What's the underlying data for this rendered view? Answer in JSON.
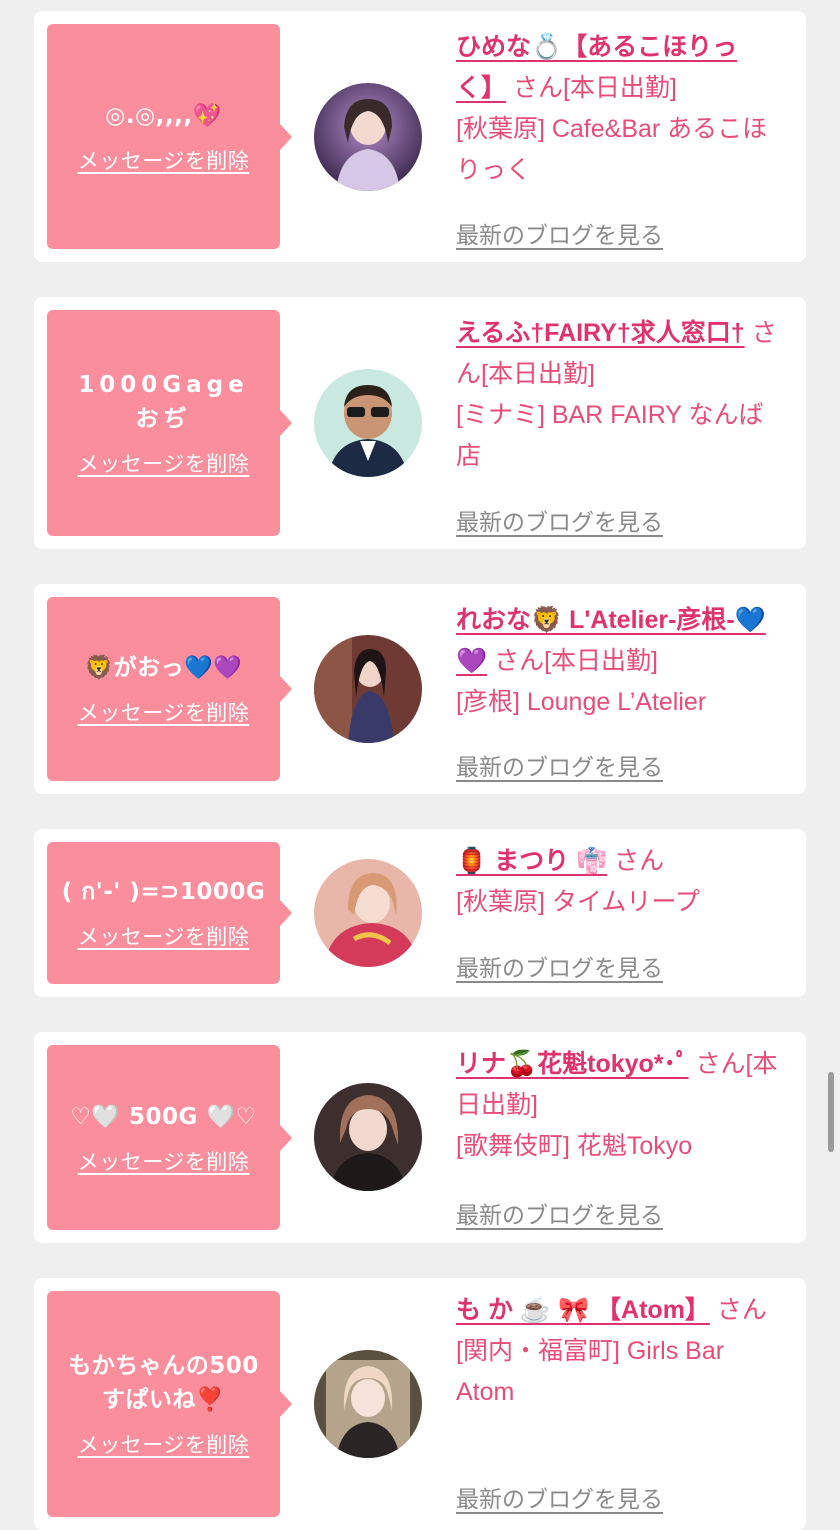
{
  "cards": [
    {
      "message": "◎.◎,,,,💖",
      "delete_label": "メッセージを削除",
      "cast_name": "ひめな💍【あるこほりっく】",
      "suffix": "さん[本日出勤]",
      "shop": "[秋葉原] Cafe&Bar あるこほりっく",
      "blog_label": "最新のブログを見る"
    },
    {
      "message": "1000Gage\nおぢ",
      "delete_label": "メッセージを削除",
      "cast_name": "えるふ†FAIRY†求人窓口†",
      "suffix": "さん[本日出勤]",
      "shop": "[ミナミ] BAR FAIRY なんば店",
      "blog_label": "最新のブログを見る"
    },
    {
      "message": "🦁がおっ💙💜",
      "delete_label": "メッセージを削除",
      "cast_name": "れおな🦁 L'Atelier-彦根-💙💜",
      "suffix": "さん[本日出勤]",
      "shop": "[彦根] Lounge L’Atelier",
      "blog_label": "最新のブログを見る"
    },
    {
      "message": "( ก'-' )=⊃1000G",
      "delete_label": "メッセージを削除",
      "cast_name": "🏮 まつり 👘",
      "suffix": "さん",
      "shop": "[秋葉原] タイムリープ",
      "blog_label": "最新のブログを見る"
    },
    {
      "message": "♡🤍 500G 🤍♡",
      "delete_label": "メッセージを削除",
      "cast_name": "リナ🍒花魁tokyo*･ﾟ",
      "suffix": "さん[本日出勤]",
      "shop": "[歌舞伎町] 花魁Tokyo",
      "blog_label": "最新のブログを見る"
    },
    {
      "message": "もかちゃんの500\nすぱいね❣️",
      "delete_label": "メッセージを削除",
      "cast_name": "も か ☕️ 🎀 【Atom】",
      "suffix": "さん",
      "shop": "[関内・福富町] Girls Bar Atom",
      "blog_label": "最新のブログを見る"
    }
  ],
  "colors": {
    "bubble": "#fb8e9c",
    "name": "#e0336c",
    "text": "#e84d78",
    "link_gray": "#8a8a8a",
    "background": "#efefef"
  }
}
